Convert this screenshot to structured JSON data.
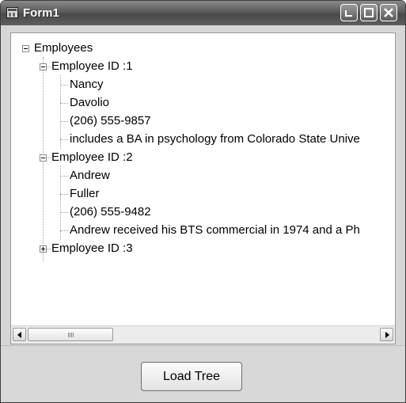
{
  "window": {
    "title": "Form1"
  },
  "tree": {
    "root": "Employees",
    "employees": [
      {
        "label": "Employee ID :1",
        "children": [
          "Nancy",
          "Davolio",
          "(206) 555-9857",
          "includes a BA in psychology from Colorado State Unive"
        ]
      },
      {
        "label": "Employee ID :2",
        "children": [
          "Andrew",
          "Fuller",
          "(206) 555-9482",
          "Andrew received his BTS commercial in 1974 and a Ph"
        ]
      },
      {
        "label": "Employee ID :3",
        "children": []
      }
    ]
  },
  "button": {
    "load_tree_label": "Load Tree"
  }
}
